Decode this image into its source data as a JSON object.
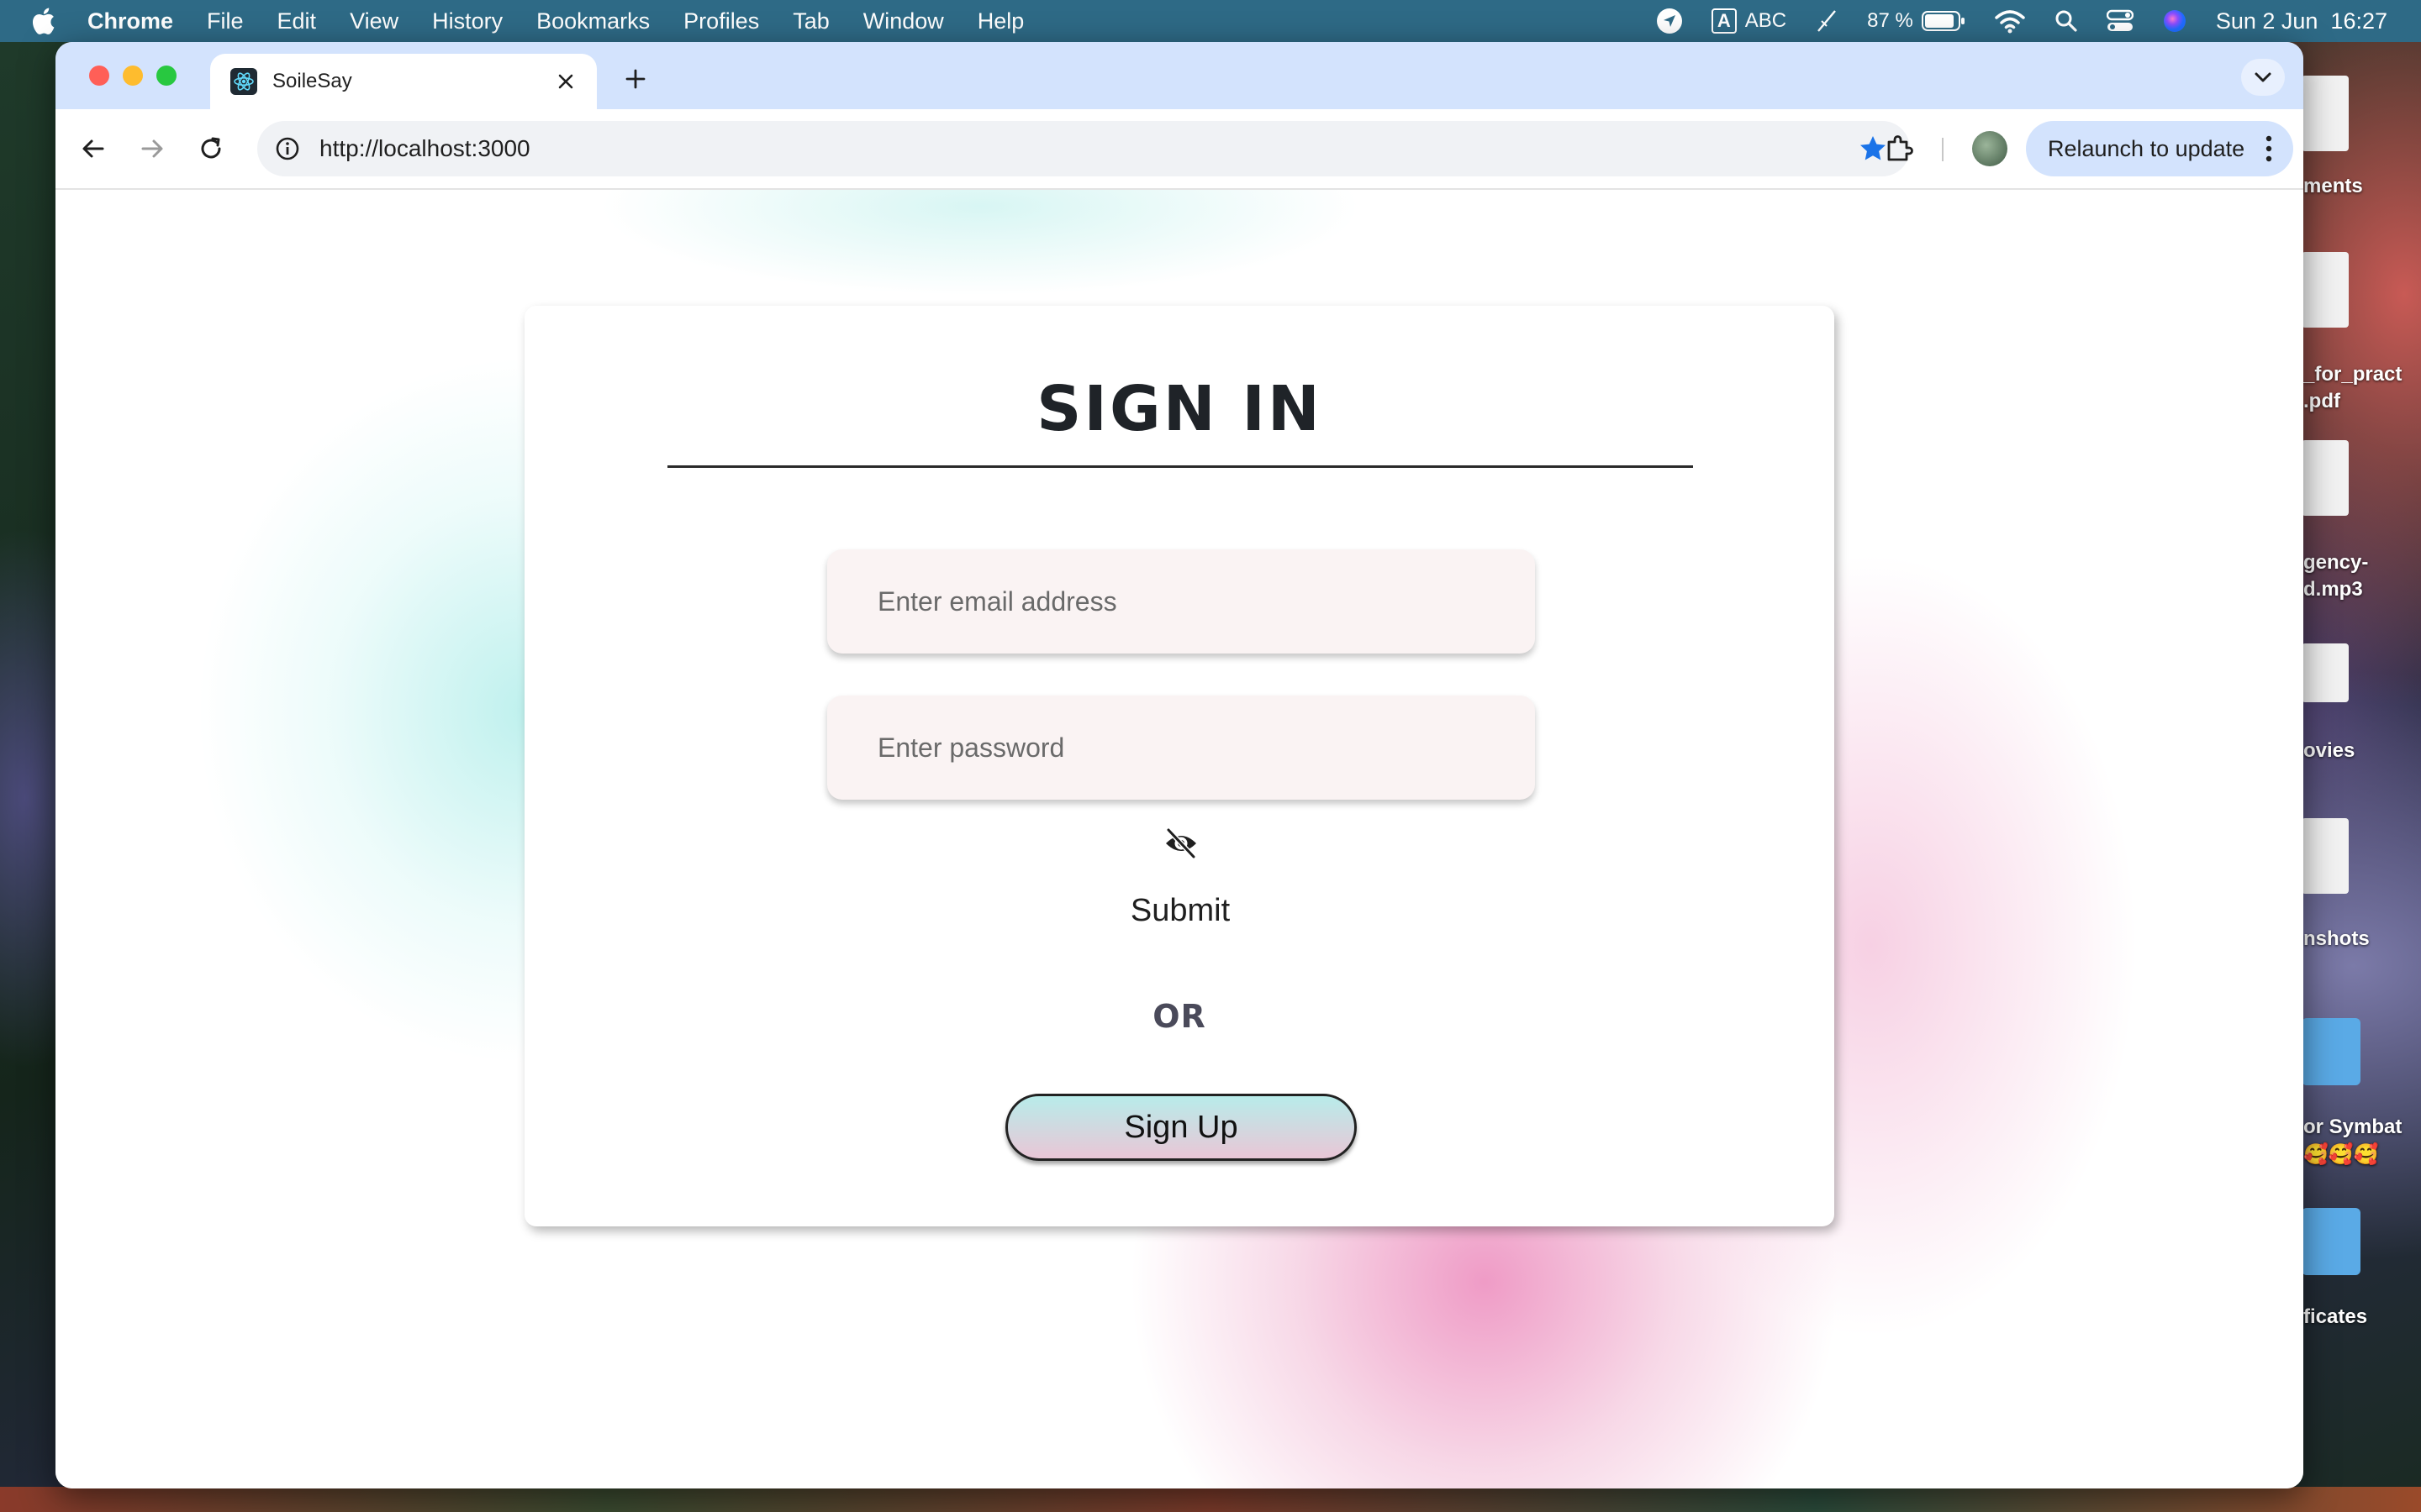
{
  "menubar": {
    "app_name": "Chrome",
    "items": [
      "File",
      "Edit",
      "View",
      "History",
      "Bookmarks",
      "Profiles",
      "Tab",
      "Window",
      "Help"
    ],
    "input_source": "ABC",
    "input_badge": "A",
    "battery": "87 %",
    "datetime": "Sun 2 Jun  16:27"
  },
  "browser": {
    "tab_title": "SoileSay",
    "url": "http://localhost:3000",
    "relaunch_label": "Relaunch to update"
  },
  "desktop": {
    "items": [
      "ments",
      "_for_pract",
      ".pdf",
      "gency-",
      "d.mp3",
      "ovies",
      "nshots",
      "or Symbat",
      "🥰🥰🥰",
      "ficates"
    ]
  },
  "page": {
    "title": "SIGN IN",
    "email_placeholder": "Enter email address",
    "password_placeholder": "Enter password",
    "submit_label": "Submit",
    "or_label": "OR",
    "signup_label": "Sign Up"
  },
  "colors": {
    "menubar": "#2e6a86",
    "tabstrip": "#d3e3fd",
    "accent_star": "#1a73e8",
    "field_bg": "#faf3f3"
  }
}
